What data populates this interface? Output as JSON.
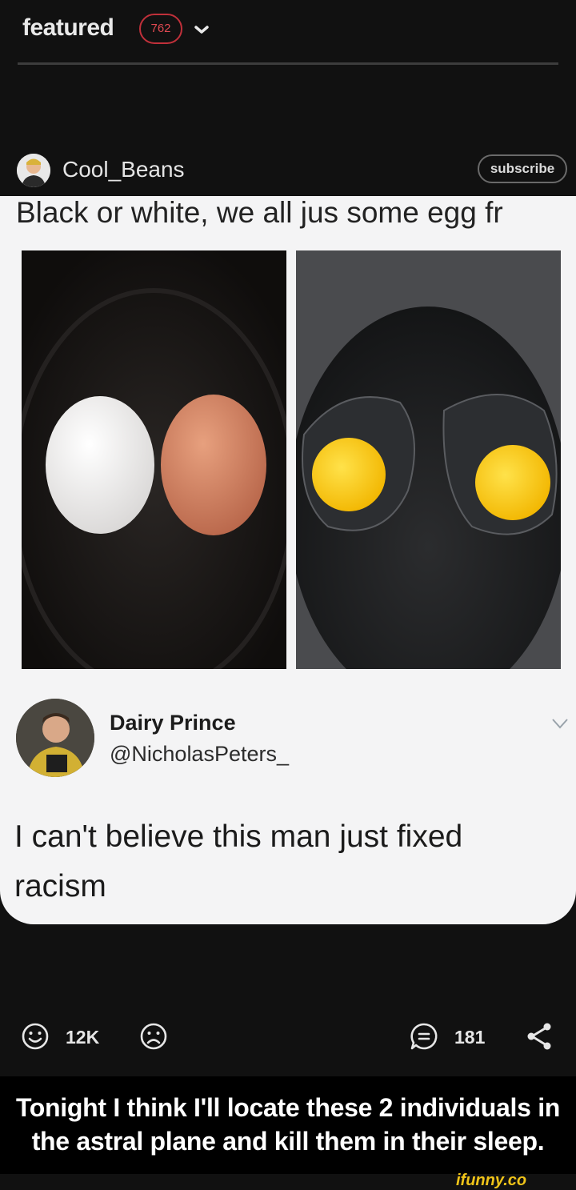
{
  "header": {
    "title": "featured",
    "badge_count": "762"
  },
  "post": {
    "author": "Cool_Beans",
    "subscribe_label": "subscribe",
    "meme": {
      "top_text": "Black or white, we all jus some egg fr",
      "tweet_name": "Dairy Prince",
      "tweet_handle": "@NicholasPeters_",
      "tweet_text": "I can't believe this man just fixed racism"
    },
    "actions": {
      "smile_count": "12K",
      "comment_count": "181"
    },
    "caption_line1": "Tonight I think I'll locate these 2 individuals in",
    "caption_line2": "the astral plane and kill them in their sleep.",
    "watermark": "ifunny.co"
  },
  "colors": {
    "background": "#111111",
    "badge_red": "#c0303a",
    "watermark_yellow": "#f0c419"
  }
}
